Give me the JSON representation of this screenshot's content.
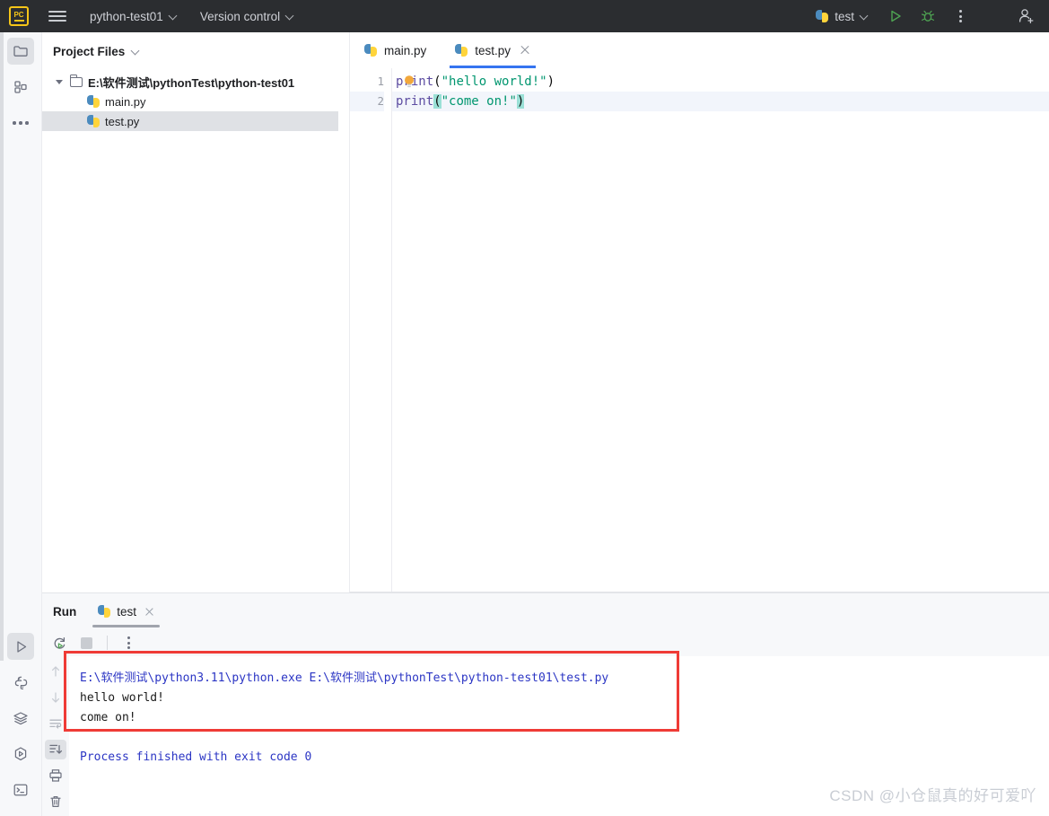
{
  "titlebar": {
    "logo_text": "PC",
    "menu_icon": "hamburger-icon",
    "project_name": "python-test01",
    "version_control": "Version control",
    "run_config_name": "test",
    "run_icon": "run-play-icon",
    "debug_icon": "debug-bug-icon",
    "more_icon": "more-vertical-icon",
    "account_icon": "add-user-icon"
  },
  "rail": {
    "top_items": [
      {
        "name": "project-folder-icon",
        "selected": true
      },
      {
        "name": "structure-icon",
        "selected": false
      },
      {
        "name": "more-tools-icon",
        "selected": false
      }
    ],
    "bottom_items": [
      {
        "name": "run-icon",
        "selected": true
      },
      {
        "name": "python-packages-icon",
        "selected": false
      },
      {
        "name": "database-icon",
        "selected": false
      },
      {
        "name": "python-console-icon",
        "selected": false
      },
      {
        "name": "terminal-icon",
        "selected": false
      }
    ]
  },
  "project": {
    "header": "Project Files",
    "root": "E:\\软件测试\\pythonTest\\python-test01",
    "files": [
      {
        "label": "main.py",
        "selected": false
      },
      {
        "label": "test.py",
        "selected": true
      }
    ]
  },
  "editor": {
    "tabs": [
      {
        "label": "main.py",
        "active": false,
        "closable": false
      },
      {
        "label": "test.py",
        "active": true,
        "closable": true
      }
    ],
    "line_numbers": [
      "1",
      "2"
    ],
    "lines": [
      {
        "number": "1",
        "current": false,
        "tokens": [
          {
            "text": "print",
            "type": "fn"
          },
          {
            "text": "(",
            "type": "paren"
          },
          {
            "text": "\"hello world!\"",
            "type": "str"
          },
          {
            "text": ")",
            "type": "paren"
          }
        ],
        "bulb_icon": "intention-bulb-icon"
      },
      {
        "number": "2",
        "current": true,
        "tokens": [
          {
            "text": "print",
            "type": "fn"
          },
          {
            "text": "(",
            "type": "paren-hl"
          },
          {
            "text": "\"come on!\"",
            "type": "str"
          },
          {
            "text": ")",
            "type": "paren-hl"
          }
        ],
        "bulb_icon": null
      }
    ]
  },
  "run_panel": {
    "title": "Run",
    "tab_label": "test",
    "toolbar": {
      "rerun_icon": "rerun-icon",
      "stop_icon": "stop-icon",
      "more_icon": "more-vertical-icon"
    },
    "gutter_icons": [
      {
        "name": "scroll-up-icon",
        "selected": false
      },
      {
        "name": "scroll-down-icon",
        "selected": false
      },
      {
        "name": "soft-wrap-icon",
        "selected": false
      },
      {
        "name": "scroll-to-end-icon",
        "selected": true
      },
      {
        "name": "print-icon",
        "selected": false
      },
      {
        "name": "clear-all-icon",
        "selected": false
      }
    ],
    "console_lines": [
      {
        "text": "E:\\软件测试\\python3.11\\python.exe E:\\软件测试\\pythonTest\\python-test01\\test.py",
        "style": "blue"
      },
      {
        "text": "hello world!",
        "style": "plain"
      },
      {
        "text": "come on!",
        "style": "plain"
      },
      {
        "text": "",
        "style": "plain"
      },
      {
        "text": "Process finished with exit code 0",
        "style": "blue"
      }
    ]
  },
  "annotation": {
    "box_color": "#ef3b36"
  },
  "watermark": {
    "text": "CSDN @小仓鼠真的好可爱吖"
  },
  "colors": {
    "titlebar_bg": "#2b2d30",
    "accent_blue": "#3574f0",
    "panel_bg": "#f7f8fa",
    "selection": "#dfe1e5",
    "string_green": "#00966f",
    "keyword_purple": "#5c4ca1",
    "console_blue": "#2b35c4",
    "brace_highlight": "#9ae0d6"
  }
}
